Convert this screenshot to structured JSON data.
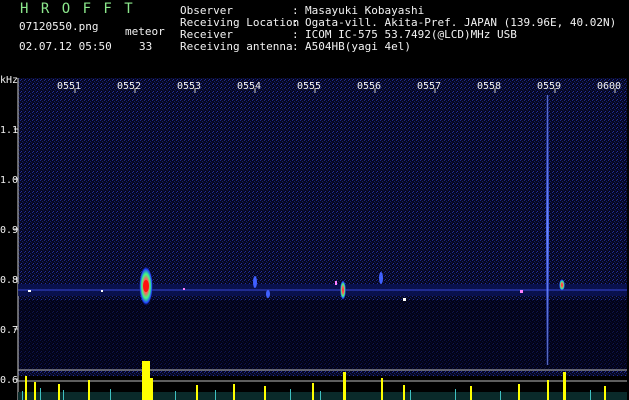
{
  "header": {
    "logo": "H R O F F T",
    "filename": "07120550.png",
    "datetime": "02.07.12 05:50",
    "count_label": "meteor",
    "count_value": "33",
    "fields": [
      {
        "key": "Observer",
        "value": "Masayuki Kobayashi"
      },
      {
        "key": "Receiving Location",
        "value": "Ogata-vill. Akita-Pref. JAPAN (139.96E, 40.02N)"
      },
      {
        "key": "Receiver",
        "value": "ICOM IC-575 53.7492(@LCD)MHz USB"
      },
      {
        "key": "Receiving antenna",
        "value": "A504HB(yagi 4el)"
      }
    ]
  },
  "axis": {
    "unit_label": "kHz",
    "time_ticks": [
      "0551",
      "0552",
      "0553",
      "0554",
      "0555",
      "0556",
      "0557",
      "0558",
      "0559",
      "0600"
    ],
    "freq_ticks": [
      "1.1",
      "1.0",
      "0.9",
      "0.8",
      "0.7",
      "0.6"
    ]
  },
  "colors": {
    "background": "#000000",
    "header_green": "#8ce88c",
    "axis_white": "#f2f2f2",
    "noise_blue": "#1a2a7a",
    "echo_red": "#ff3030",
    "histogram_yellow": "#ffff00",
    "histogram_cyan": "#40c0c0"
  }
}
